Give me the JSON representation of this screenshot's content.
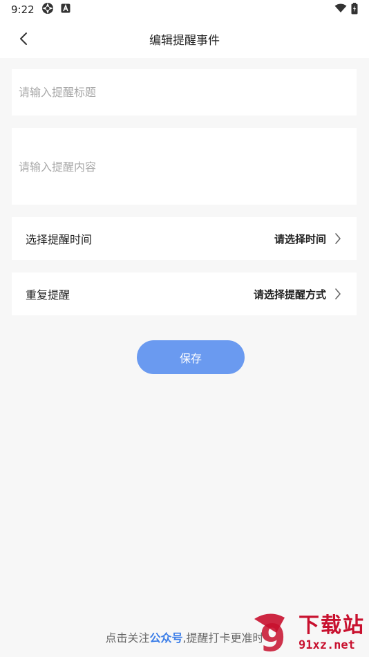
{
  "status_bar": {
    "time": "9:22"
  },
  "header": {
    "title": "编辑提醒事件"
  },
  "form": {
    "title_placeholder": "请输入提醒标题",
    "content_placeholder": "请输入提醒内容",
    "time_label": "选择提醒时间",
    "time_value": "请选择时间",
    "repeat_label": "重复提醒",
    "repeat_value": "请选择提醒方式"
  },
  "actions": {
    "save_label": "保存"
  },
  "footer": {
    "prefix": "点击关注",
    "link": "公众号",
    "suffix": ",提醒打卡更准时"
  },
  "watermark": {
    "text": "下载站",
    "url": "91xz.net",
    "logo": "9"
  },
  "colors": {
    "accent": "#6a9af0",
    "link": "#3c7ee8",
    "background": "#f7f7f7",
    "watermark": "#c8102e"
  }
}
